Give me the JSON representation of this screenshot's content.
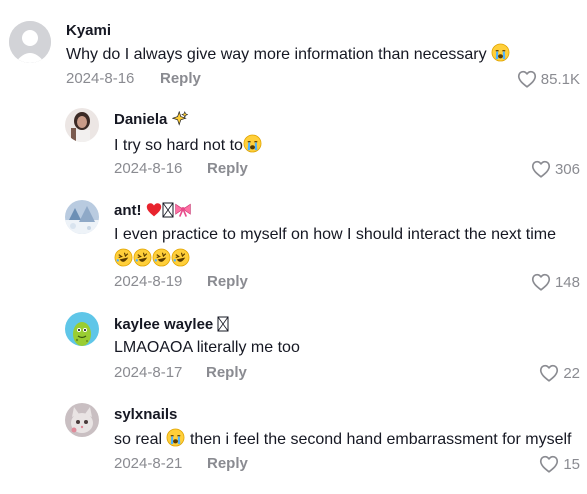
{
  "comments": [
    {
      "username": "Kyami",
      "text": "Why do I always give way more information than necessary",
      "date": "2024-8-16",
      "reply": "Reply",
      "likes": "85.1K",
      "avatar": "default-avatar"
    },
    {
      "username": "Daniela",
      "text": "I try so hard not to",
      "date": "2024-8-16",
      "reply": "Reply",
      "likes": "306",
      "avatar": "photo-avatar"
    },
    {
      "username": "ant!",
      "text": "I even practice to myself on how I should interact the next time",
      "date": "2024-8-19",
      "reply": "Reply",
      "likes": "148",
      "avatar": "snow-avatar"
    },
    {
      "username": "kaylee waylee",
      "text": "LMAOAOA literally me too",
      "date": "2024-8-17",
      "reply": "Reply",
      "likes": "22",
      "avatar": "cartoon-avatar"
    },
    {
      "username": "sylxnails",
      "text_before": "so real",
      "text_after": "then i feel the second hand embarrassment for myself",
      "date": "2024-8-21",
      "reply": "Reply",
      "likes": "15",
      "avatar": "cat-avatar"
    }
  ],
  "colors": {
    "meta": "#8a8b91",
    "text": "#161823",
    "heart_emoji": "#e8232d",
    "bow_emoji": "#ff6fa3"
  }
}
